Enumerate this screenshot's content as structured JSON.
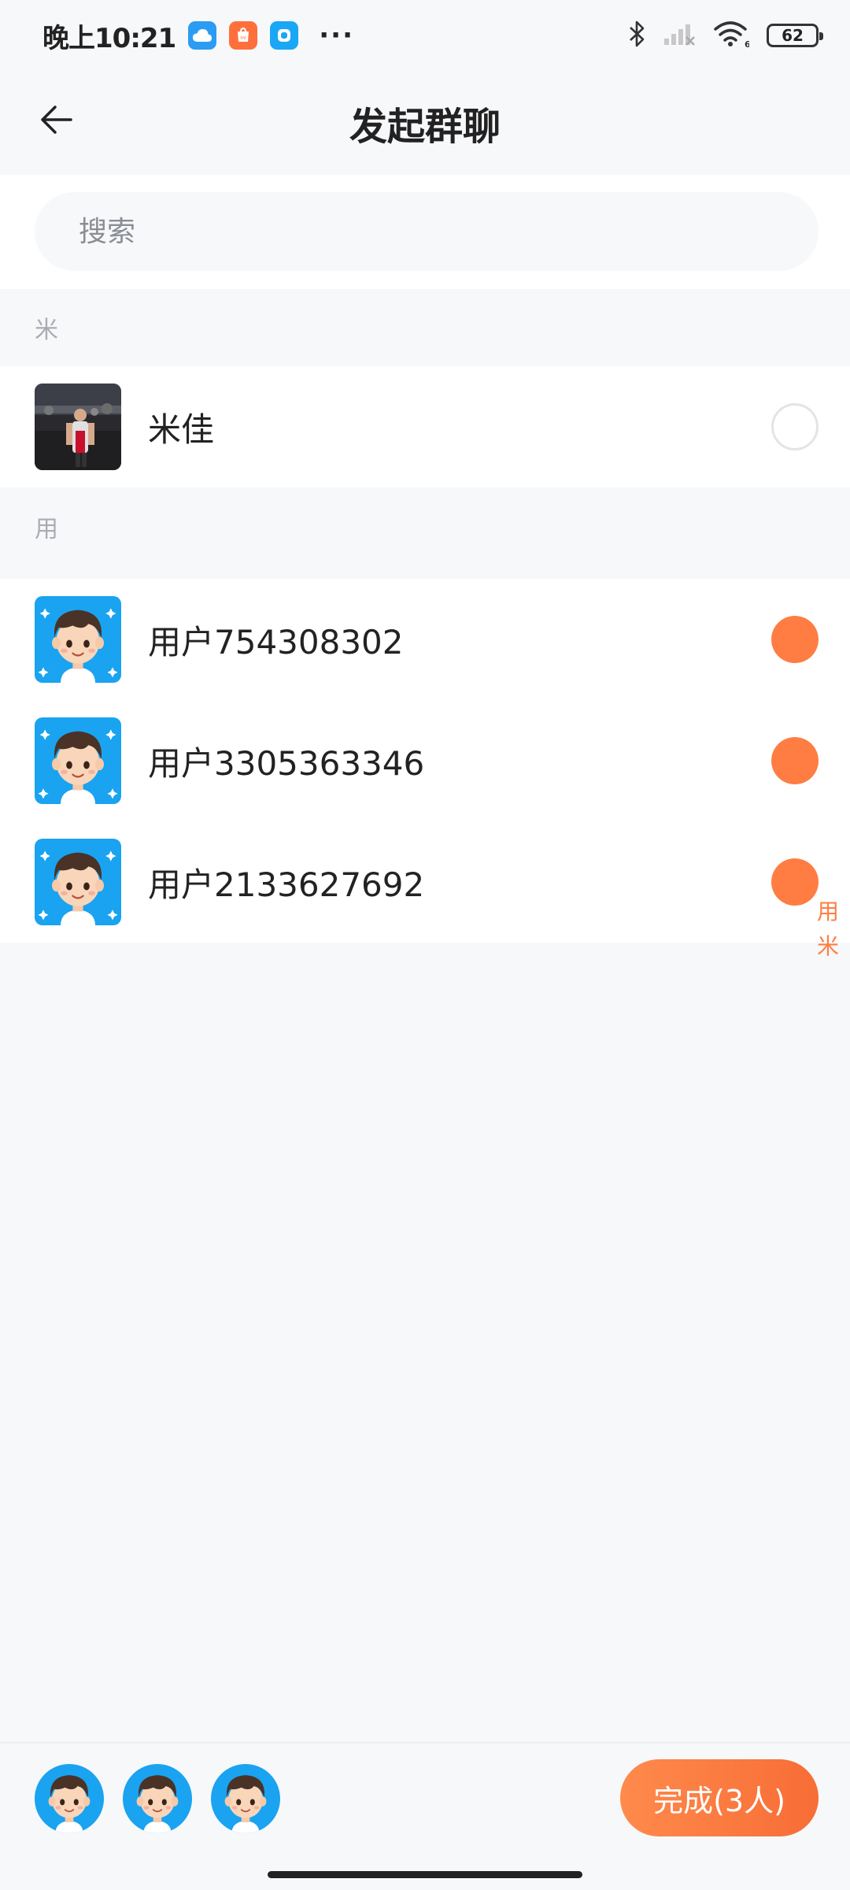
{
  "status_bar": {
    "time": "晚上10:21",
    "more": "···",
    "battery": "62",
    "icons": [
      "cloud-app-icon",
      "shop-app-icon",
      "message-app-icon",
      "bluetooth-icon",
      "signal-icon",
      "wifi-icon",
      "battery-icon"
    ]
  },
  "header": {
    "title": "发起群聊",
    "back_icon": "arrow-left-icon"
  },
  "search": {
    "placeholder": "搜索"
  },
  "sections": [
    {
      "letter": "米",
      "contacts": [
        {
          "name": "米佳",
          "selected": false
        }
      ]
    },
    {
      "letter": "用",
      "contacts": [
        {
          "name": "用户754308302",
          "selected": true
        },
        {
          "name": "用户3305363346",
          "selected": true
        },
        {
          "name": "用户2133627692",
          "selected": true
        }
      ]
    }
  ],
  "index_bar": [
    "用",
    "米"
  ],
  "bottom": {
    "done_label": "完成(3人)",
    "selected_count": 3
  },
  "colors": {
    "accent": "#ff7d43",
    "background": "#f7f8fa",
    "avatar_blue": "#1aa3f0"
  }
}
